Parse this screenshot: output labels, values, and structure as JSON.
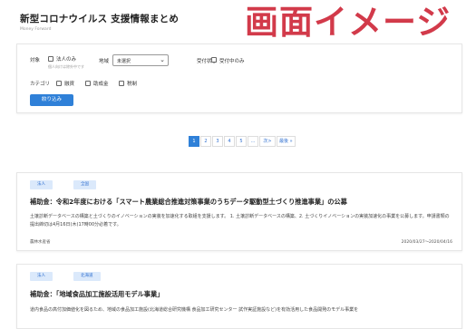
{
  "header": {
    "title": "新型コロナウイルス 支援情報まとめ",
    "subtitle": "Money Forward",
    "watermark": "画面イメージ"
  },
  "filters": {
    "target_label": "対象",
    "target_option": "法人のみ",
    "target_note": "個人向けは除外中です",
    "region_label": "地域",
    "region_value": "未選択",
    "accepting_label": "受付状態",
    "accepting_option": "受付中のみ",
    "category_label": "カテゴリ",
    "categories": [
      "融資",
      "助成金",
      "税制"
    ],
    "search_button": "絞り込み"
  },
  "pagination": {
    "pages": [
      "1",
      "2",
      "3",
      "4",
      "5"
    ],
    "ellipsis": "…",
    "next": "次>",
    "last": "最後 »",
    "current": "1"
  },
  "results": [
    {
      "tags": [
        "法人",
        "全国"
      ],
      "title": "補助金：令和2年度における「スマート農業総合推進対策事業のうちデータ駆動型土づくり推進事業」の公募",
      "description": "土壌診断データベースの構築と土づくりのイノベーションの実装を加速化する取組を支援します。 1. 土壌診断データベースの構築、2. 土づくりイノベーションの実装加速化の事業を公募します。申請書類の提出締切は4月16日(木)17時00分必着です。",
      "source": "農林水産省",
      "period": "2020/03/27〜2020/04/16"
    },
    {
      "tags": [
        "法人",
        "北海道"
      ],
      "title": "補助金：「地域食品加工施設活用モデル事業」",
      "description": "道内食品の高付加価値化を図るため、地域の食品加工施設(北海道総合研究機構 食品加工研究センター 試作実証施設など)を有効活用した食品開発のモデル事業を"
    }
  ],
  "colors": {
    "accent": "#2f80d8",
    "watermark": "#d23a4a",
    "tag_bg": "#dbe9fb"
  }
}
